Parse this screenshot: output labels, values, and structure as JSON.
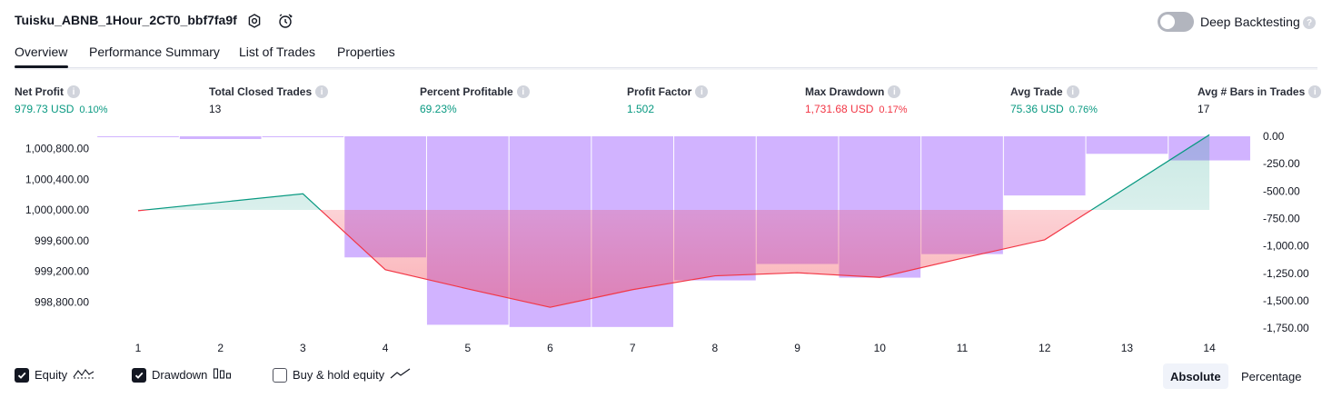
{
  "header": {
    "strategy_name": "Tuisku_ABNB_1Hour_2CT0_bbf7fa9f",
    "deep_backtesting_label": "Deep Backtesting",
    "deep_backtesting_enabled": false
  },
  "tabs": [
    {
      "label": "Overview",
      "active": true
    },
    {
      "label": "Performance Summary",
      "active": false
    },
    {
      "label": "List of Trades",
      "active": false
    },
    {
      "label": "Properties",
      "active": false
    }
  ],
  "metrics": [
    {
      "label": "Net Profit",
      "value": "979.73 USD",
      "sub": "0.10%",
      "tone": "pos"
    },
    {
      "label": "Total Closed Trades",
      "value": "13",
      "sub": "",
      "tone": "neutral"
    },
    {
      "label": "Percent Profitable",
      "value": "69.23%",
      "sub": "",
      "tone": "pos"
    },
    {
      "label": "Profit Factor",
      "value": "1.502",
      "sub": "",
      "tone": "pos"
    },
    {
      "label": "Max Drawdown",
      "value": "1,731.68 USD",
      "sub": "0.17%",
      "tone": "neg"
    },
    {
      "label": "Avg Trade",
      "value": "75.36 USD",
      "sub": "0.76%",
      "tone": "pos"
    },
    {
      "label": "Avg # Bars in Trades",
      "value": "17",
      "sub": "",
      "tone": "neutral"
    }
  ],
  "chart_data": {
    "type": "line",
    "x": [
      1,
      2,
      3,
      4,
      5,
      6,
      7,
      8,
      9,
      10,
      11,
      12,
      13,
      14
    ],
    "left_axis_ticks": [
      "1,000,800.00",
      "1,000,400.00",
      "1,000,000.00",
      "999,600.00",
      "999,200.00",
      "998,800.00"
    ],
    "left_axis_values": [
      1000800,
      1000400,
      1000000,
      999600,
      999200,
      998800
    ],
    "right_axis_ticks": [
      "0.00",
      "-250.00",
      "-500.00",
      "-750.00",
      "-1,000.00",
      "-1,250.00",
      "-1,500.00",
      "-1,750.00"
    ],
    "right_axis_values": [
      0,
      -250,
      -500,
      -750,
      -1000,
      -1250,
      -1500,
      -1750
    ],
    "equity": {
      "name": "Equity",
      "x": [
        1,
        3,
        4,
        5,
        6,
        7,
        8,
        9,
        10,
        11,
        12,
        14
      ],
      "values": [
        999990,
        1000210,
        999220,
        998970,
        998730,
        998960,
        999140,
        999180,
        999120,
        999370,
        999610,
        1000980
      ]
    },
    "drawdown": {
      "name": "Drawdown",
      "values": [
        -5,
        -25,
        -5,
        -1105,
        -1720,
        -1740,
        -1740,
        -1315,
        -1165,
        -1290,
        -1075,
        -540,
        -160,
        -220
      ]
    },
    "colors": {
      "equity_up": "#089981",
      "equity_down": "#f23645",
      "drawdown": "#d1b3ff"
    }
  },
  "legend": {
    "equity_label": "Equity",
    "drawdown_label": "Drawdown",
    "buyhold_label": "Buy & hold equity",
    "equity_checked": true,
    "drawdown_checked": true,
    "buyhold_checked": false
  },
  "view_toggle": {
    "absolute_label": "Absolute",
    "percentage_label": "Percentage",
    "active": "Absolute"
  }
}
